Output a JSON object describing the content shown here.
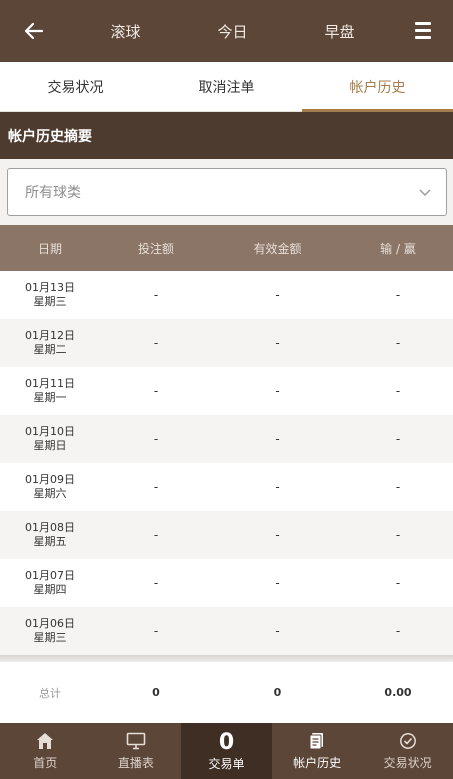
{
  "topbar": {
    "tabs": [
      "滚球",
      "今日",
      "早盘"
    ],
    "back_icon": "arrow-left-icon",
    "menu_icon": "hamburger-menu-icon"
  },
  "subtabs": [
    "交易状况",
    "取消注单",
    "帐户历史"
  ],
  "active_subtab": "帐户历史",
  "section_title": "帐户历史摘要",
  "sport_select": {
    "value": "所有球类",
    "icon": "chevron-down-icon"
  },
  "table": {
    "headers": [
      "日期",
      "投注额",
      "有效金额",
      "输 / 赢"
    ],
    "rows": [
      {
        "date": "01月13日",
        "weekday": "星期三",
        "stake": "-",
        "valid": "-",
        "winloss": "-"
      },
      {
        "date": "01月12日",
        "weekday": "星期二",
        "stake": "-",
        "valid": "-",
        "winloss": "-"
      },
      {
        "date": "01月11日",
        "weekday": "星期一",
        "stake": "-",
        "valid": "-",
        "winloss": "-"
      },
      {
        "date": "01月10日",
        "weekday": "星期日",
        "stake": "-",
        "valid": "-",
        "winloss": "-"
      },
      {
        "date": "01月09日",
        "weekday": "星期六",
        "stake": "-",
        "valid": "-",
        "winloss": "-"
      },
      {
        "date": "01月08日",
        "weekday": "星期五",
        "stake": "-",
        "valid": "-",
        "winloss": "-"
      },
      {
        "date": "01月07日",
        "weekday": "星期四",
        "stake": "-",
        "valid": "-",
        "winloss": "-"
      },
      {
        "date": "01月06日",
        "weekday": "星期三",
        "stake": "-",
        "valid": "-",
        "winloss": "-"
      }
    ],
    "total": {
      "label": "总计",
      "stake": "0",
      "valid": "0",
      "winloss": "0.00"
    }
  },
  "bottom_nav": [
    {
      "label": "首页",
      "icon": "home-icon"
    },
    {
      "label": "直播表",
      "icon": "monitor-icon"
    },
    {
      "label": "交易单",
      "count": "0"
    },
    {
      "label": "帐户历史",
      "icon": "document-icon"
    },
    {
      "label": "交易状况",
      "icon": "check-circle-icon"
    }
  ],
  "colors": {
    "brand_dark": "#5b4638",
    "accent": "#a57c4b",
    "header_bar": "#4e3b2f",
    "table_head": "#8a7567"
  }
}
